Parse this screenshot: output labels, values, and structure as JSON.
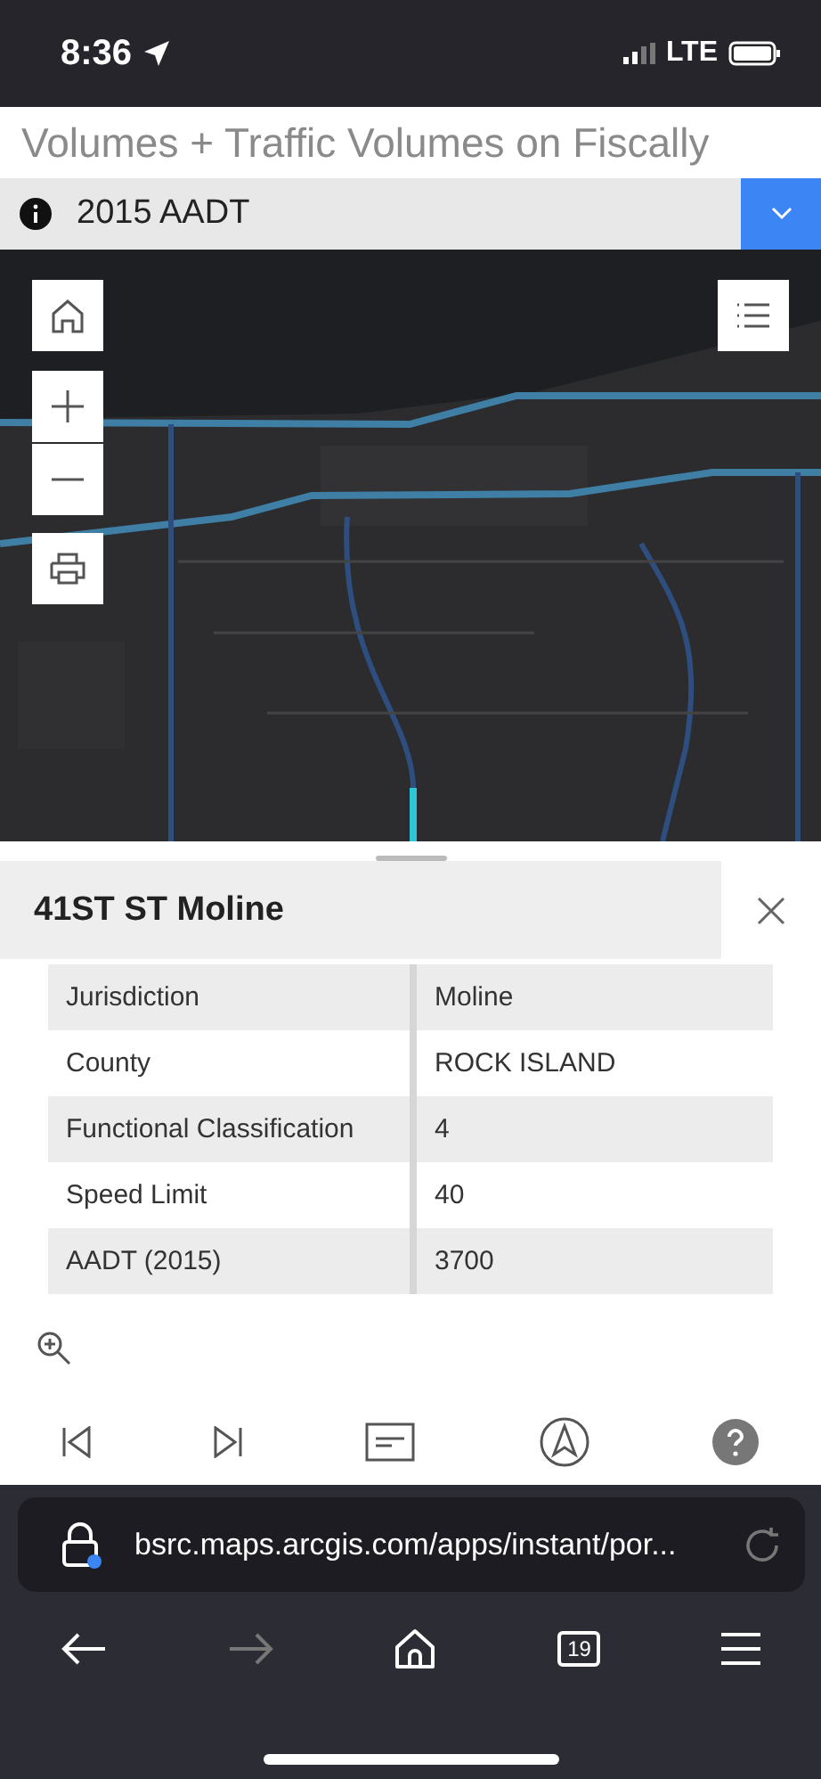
{
  "status_bar": {
    "time": "8:36",
    "network": "LTE"
  },
  "app_title": "Volumes + Traffic Volumes on Fiscally",
  "layer_selector": {
    "label": "2015 AADT",
    "expanded": false
  },
  "popup": {
    "title": "41ST ST Moline",
    "rows": [
      {
        "field": "Jurisdiction",
        "value": "Moline"
      },
      {
        "field": "County",
        "value": "ROCK ISLAND"
      },
      {
        "field": "Functional Classification",
        "value": "4"
      },
      {
        "field": "Speed Limit",
        "value": "40"
      },
      {
        "field": "AADT (2015)",
        "value": "3700"
      }
    ]
  },
  "browser": {
    "url": "bsrc.maps.arcgis.com/apps/instant/por...",
    "tab_count": "19"
  }
}
